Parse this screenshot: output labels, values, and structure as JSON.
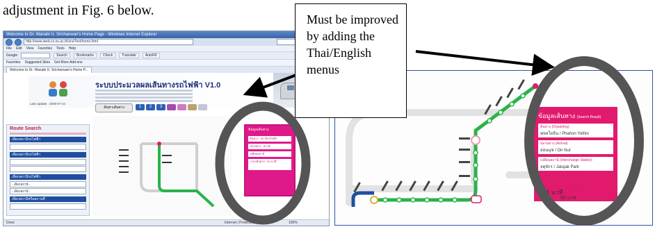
{
  "caption": "adjustment in Fig. 6 below.",
  "callout": {
    "text": "Must be improved by adding the Thai/English menus"
  },
  "browser": {
    "window_title": "Welcome to Dr. Wanabi U. Srichanwan's Home Page - Windows Internet Explorer",
    "url": "http://www.iweb.cs.nu.ac.th/sra/Test/home.html",
    "menu": [
      "File",
      "Edit",
      "View",
      "Favorites",
      "Tools",
      "Help"
    ],
    "toolbar_search_engine": "Google",
    "toolbar_items": [
      "Search",
      "Bookmarks",
      "Check",
      "Translate",
      "AutoFill"
    ],
    "favorites": [
      "Favorites",
      "Suggested Sites",
      "Get More Add-ons"
    ],
    "tab_label": "Welcome to Dr. Wanabi U. Srichanwan's Home P...",
    "status_left": "Done",
    "status_middle": "Internet | Protected Mode: On",
    "status_zoom": "100%"
  },
  "page": {
    "system_title": "ระบบประมวลผลเส้นทางรถไฟฟ้า  V1.0",
    "last_update": "Last Update : 2009-07-24",
    "go_button": "ค้นหาเส้นทาง",
    "number_buttons": [
      "1",
      "2",
      "3"
    ],
    "route_panel": {
      "title": "Route Search",
      "bars": [
        "เลือกสถานีรถไฟฟ้า",
        "เลือกสถานีรถไฟฟ้า",
        "เลือกสถานีรถไฟฟ้า",
        "เลือกสถานีหรือสถานที่"
      ],
      "selects": [
        "- เลือกสถานี -",
        "- เลือกสถานี -"
      ]
    },
    "info_box": {
      "title": "ข้อมูลเส้นทาง",
      "rows": [
        "ต้นทาง : สถานีรถไฟฟ้า",
        "ปลายทาง : สถานี",
        "เปลี่ยนสถานี",
        "เวลาเดินทาง : 34 นาที"
      ]
    }
  },
  "result": {
    "header": "ข้อมูลเส้นทาง",
    "header_sub": "(Search Result)",
    "departure_label": "ต้นทาง (Departing)",
    "departure_value": "พหลโยธิน / Phahon Yothin",
    "destination_label": "ปลายทาง (Arrival)",
    "destination_value": "อ่อนนุช / On Nut",
    "interchange_label": "เปลี่ยนสถานี (Interchange Station)",
    "interchange_value": "จตุจักร / Jatujak Park",
    "time_label": "เวลาเดินทางประมาณ (Journey Time)",
    "time_value": "34 นาที",
    "price_label": "ราคา (Price) :",
    "price_value": "52 บาท"
  },
  "colors": {
    "route_green": "#2ab34a",
    "result_pink": "#e21a6e",
    "circle_grey": "#555555",
    "callout_arrow": "#000000"
  }
}
